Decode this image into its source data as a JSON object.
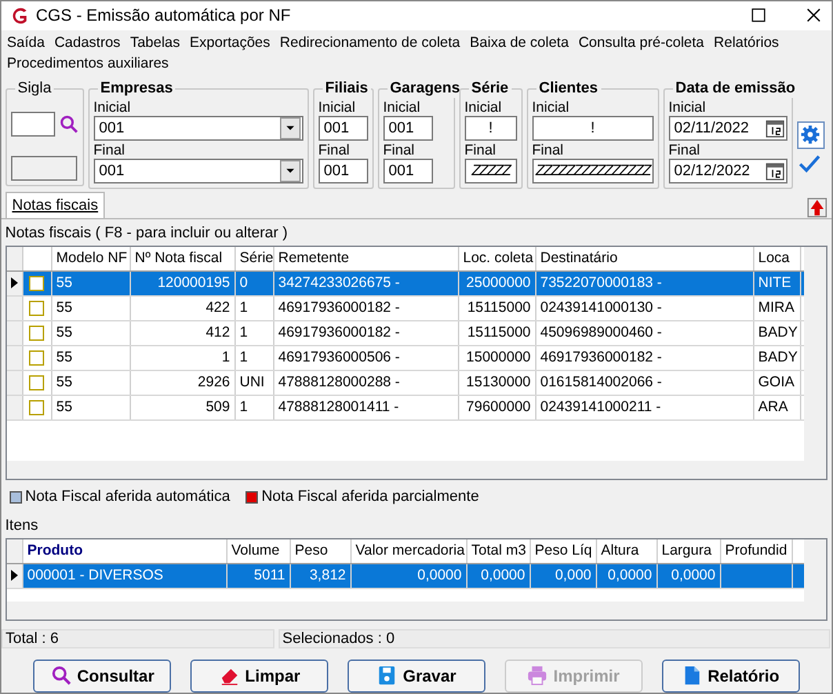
{
  "window": {
    "title": "CGS - Emissão automática por NF"
  },
  "menu": [
    "Saída",
    "Cadastros",
    "Tabelas",
    "Exportações",
    "Redirecionamento de coleta",
    "Baixa de coleta",
    "Consulta pré-coleta",
    "Relatórios",
    "Procedimentos auxiliares"
  ],
  "filters": {
    "sigla": {
      "title": "Sigla"
    },
    "empresas": {
      "title": "Empresas",
      "initial_label": "Inicial",
      "initial": "001",
      "final_label": "Final",
      "final": "001"
    },
    "filiais": {
      "title": "Filiais",
      "initial_label": "Inicial",
      "initial": "001",
      "final_label": "Final",
      "final": "001"
    },
    "garagens": {
      "title": "Garagens",
      "initial_label": "Inicial",
      "initial": "001",
      "final_label": "Final",
      "final": "001"
    },
    "serie": {
      "title": "Série",
      "initial_label": "Inicial",
      "initial": "!",
      "final_label": "Final",
      "final": "ZZZZZ"
    },
    "clientes": {
      "title": "Clientes",
      "initial_label": "Inicial",
      "initial": "!",
      "final_label": "Final",
      "final": "ZZZZZZZZZZZZZZZ"
    },
    "data_emissao": {
      "title": "Data de emissão",
      "initial_label": "Inicial",
      "initial": "02/11/2022",
      "final_label": "Final",
      "final": "02/12/2022"
    }
  },
  "tabs": [
    {
      "label": "Notas fiscais",
      "selected": true
    }
  ],
  "notas": {
    "caption": "Notas fiscais ( F8 - para incluir ou alterar )",
    "columns": [
      "Modelo NF",
      "Nº Nota fiscal",
      "Série",
      "Remetente",
      "Loc. coleta",
      "Destinatário",
      "Loca"
    ],
    "rows": [
      {
        "selected": true,
        "checked": false,
        "cells": [
          "55",
          "120000195",
          "0",
          "34274233026675 -",
          "25000000",
          "73522070000183 -",
          "NITE"
        ]
      },
      {
        "selected": false,
        "checked": false,
        "cells": [
          "55",
          "422",
          "1",
          "46917936000182 -",
          "15115000",
          "02439141000130 -",
          "MIRA"
        ]
      },
      {
        "selected": false,
        "checked": false,
        "cells": [
          "55",
          "412",
          "1",
          "46917936000182 -",
          "15115000",
          "45096989000460 -",
          "BADY"
        ]
      },
      {
        "selected": false,
        "checked": false,
        "cells": [
          "55",
          "1",
          "1",
          "46917936000506 -",
          "15000000",
          "46917936000182 -",
          "BADY"
        ]
      },
      {
        "selected": false,
        "checked": false,
        "cells": [
          "55",
          "2926",
          "UNI",
          "47888128000288 -",
          "15130000",
          "01615814002066 -",
          "GOIA"
        ]
      },
      {
        "selected": false,
        "checked": false,
        "cells": [
          "55",
          "509",
          "1",
          "47888128001411 -",
          "79600000",
          "02439141000211 -",
          "ARA"
        ]
      }
    ]
  },
  "legend": [
    {
      "label": "Nota Fiscal aferida automática",
      "color": "#a9bfdc"
    },
    {
      "label": "Nota Fiscal aferida parcialmente",
      "color": "#e00000"
    }
  ],
  "itens": {
    "caption": "Itens",
    "columns": [
      "Produto",
      "Volume",
      "Peso",
      "Valor mercadoria",
      "Total m3",
      "Peso Líq",
      "Altura",
      "Largura",
      "Profundid"
    ],
    "rows": [
      {
        "selected": true,
        "cells": [
          "000001 - DIVERSOS",
          "5011",
          "3,812",
          "0,0000",
          "0,0000",
          "0,000",
          "0,0000",
          "0,0000",
          ""
        ]
      }
    ]
  },
  "status_bar": [
    "Total : 6",
    "Selecionados : 0"
  ],
  "buttons": [
    {
      "kind": "search",
      "label": "Consultar",
      "disabled": false
    },
    {
      "kind": "eraser",
      "label": "Limpar",
      "disabled": false
    },
    {
      "kind": "save",
      "label": "Gravar",
      "disabled": false
    },
    {
      "kind": "print",
      "label": "Imprimir",
      "disabled": true
    },
    {
      "kind": "doc",
      "label": "Relatório",
      "disabled": false
    }
  ]
}
